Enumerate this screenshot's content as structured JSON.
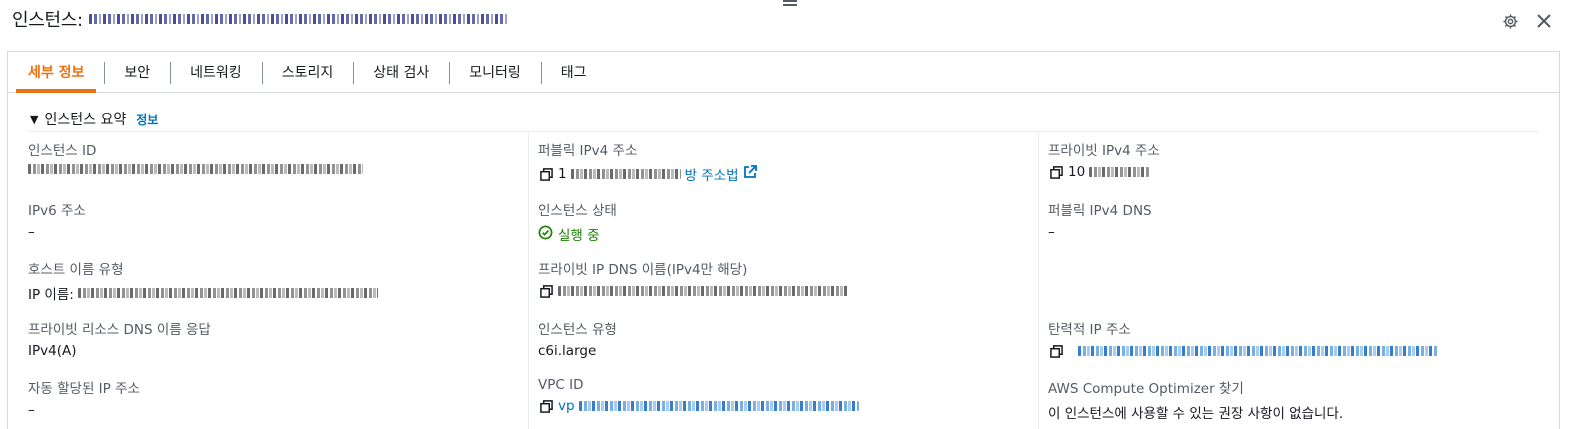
{
  "header": {
    "title_prefix": "인스턴스:"
  },
  "tabs": [
    {
      "label": "세부 정보"
    },
    {
      "label": "보안"
    },
    {
      "label": "네트워킹"
    },
    {
      "label": "스토리지"
    },
    {
      "label": "상태 검사"
    },
    {
      "label": "모니터링"
    },
    {
      "label": "태그"
    }
  ],
  "section": {
    "title": "인스턴스 요약",
    "info_link": "정보"
  },
  "fields": {
    "instance_id": {
      "label": "인스턴스 ID"
    },
    "ipv6": {
      "label": "IPv6 주소",
      "value": "–"
    },
    "hostname_type": {
      "label": "호스트 이름 유형",
      "value_prefix": "IP 이름:"
    },
    "private_dns_answer": {
      "label": "프라이빗 리소스 DNS 이름 응답",
      "value": "IPv4(A)"
    },
    "auto_ip": {
      "label": "자동 할당된 IP 주소",
      "value": "–"
    },
    "public_ipv4": {
      "label": "퍼블릭 IPv4 주소",
      "value_prefix": "1",
      "link_suffix": "방 주소법"
    },
    "state": {
      "label": "인스턴스 상태",
      "value": "실행 중"
    },
    "private_ip_dns": {
      "label": "프라이빗 IP DNS 이름(IPv4만 해당)"
    },
    "instance_type": {
      "label": "인스턴스 유형",
      "value": "c6i.large"
    },
    "vpc_id": {
      "label": "VPC ID",
      "value_prefix": "vp"
    },
    "private_ipv4": {
      "label": "프라이빗 IPv4 주소",
      "value_prefix": "10"
    },
    "public_dns": {
      "label": "퍼블릭 IPv4 DNS",
      "value": "–"
    },
    "elastic_ip": {
      "label": "탄력적 IP 주소"
    },
    "optimizer": {
      "label": "AWS Compute Optimizer 찾기",
      "value": "이 인스턴스에 사용할 수 있는 권장 사항이 없습니다."
    }
  },
  "colors": {
    "accent": "#ec7211",
    "link": "#0073bb",
    "success": "#1d8102"
  }
}
